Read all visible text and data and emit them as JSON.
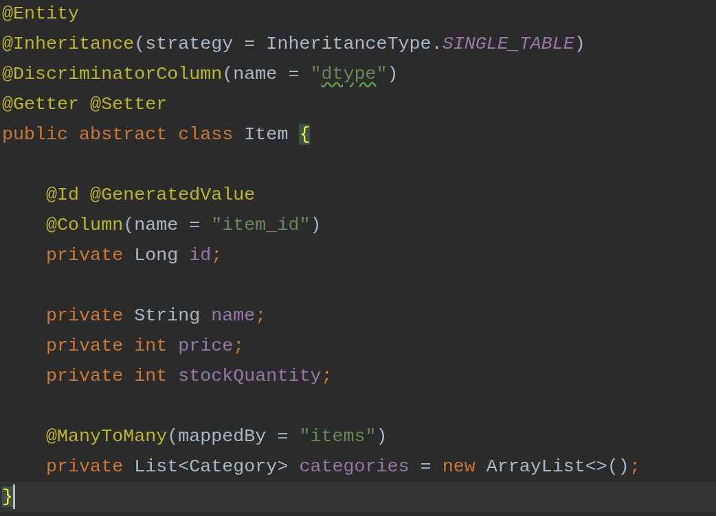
{
  "editor": {
    "lines": [
      {
        "kind": "code",
        "current": false,
        "tokens": [
          {
            "text": "@Entity",
            "kind": "annotation"
          }
        ]
      },
      {
        "kind": "code",
        "current": false,
        "tokens": [
          {
            "text": "@Inheritance",
            "kind": "annotation"
          },
          {
            "text": "(strategy = InheritanceType.",
            "kind": "plain"
          },
          {
            "text": "SINGLE_TABLE",
            "kind": "constant"
          },
          {
            "text": ")",
            "kind": "plain"
          }
        ]
      },
      {
        "kind": "code",
        "current": false,
        "tokens": [
          {
            "text": "@DiscriminatorColumn",
            "kind": "annotation"
          },
          {
            "text": "(name = ",
            "kind": "plain"
          },
          {
            "text": "\"",
            "kind": "string"
          },
          {
            "text": "dtype",
            "kind": "string",
            "squiggle": true
          },
          {
            "text": "\"",
            "kind": "string"
          },
          {
            "text": ")",
            "kind": "plain"
          }
        ]
      },
      {
        "kind": "code",
        "current": false,
        "tokens": [
          {
            "text": "@Getter @Setter",
            "kind": "annotation"
          }
        ]
      },
      {
        "kind": "code",
        "current": false,
        "tokens": [
          {
            "text": "public abstract class ",
            "kind": "keyword"
          },
          {
            "text": "Item ",
            "kind": "plain"
          },
          {
            "text": "{",
            "kind": "brace",
            "matched": true
          }
        ]
      },
      {
        "kind": "blank"
      },
      {
        "kind": "code",
        "current": false,
        "tokens": [
          {
            "text": "    @Id @GeneratedValue",
            "kind": "annotation"
          }
        ]
      },
      {
        "kind": "code",
        "current": false,
        "tokens": [
          {
            "text": "    @Column",
            "kind": "annotation"
          },
          {
            "text": "(name = ",
            "kind": "plain"
          },
          {
            "text": "\"item_id\"",
            "kind": "string"
          },
          {
            "text": ")",
            "kind": "plain"
          }
        ]
      },
      {
        "kind": "code",
        "current": false,
        "tokens": [
          {
            "text": "    private ",
            "kind": "keyword"
          },
          {
            "text": "Long ",
            "kind": "plain"
          },
          {
            "text": "id",
            "kind": "field"
          },
          {
            "text": ";",
            "kind": "keyword"
          }
        ]
      },
      {
        "kind": "blank"
      },
      {
        "kind": "code",
        "current": false,
        "tokens": [
          {
            "text": "    private ",
            "kind": "keyword"
          },
          {
            "text": "String ",
            "kind": "plain"
          },
          {
            "text": "name",
            "kind": "field"
          },
          {
            "text": ";",
            "kind": "keyword"
          }
        ]
      },
      {
        "kind": "code",
        "current": false,
        "tokens": [
          {
            "text": "    private int ",
            "kind": "keyword"
          },
          {
            "text": "price",
            "kind": "field"
          },
          {
            "text": ";",
            "kind": "keyword"
          }
        ]
      },
      {
        "kind": "code",
        "current": false,
        "tokens": [
          {
            "text": "    private int ",
            "kind": "keyword"
          },
          {
            "text": "stockQuantity",
            "kind": "field"
          },
          {
            "text": ";",
            "kind": "keyword"
          }
        ]
      },
      {
        "kind": "blank"
      },
      {
        "kind": "code",
        "current": false,
        "tokens": [
          {
            "text": "    @ManyToMany",
            "kind": "annotation"
          },
          {
            "text": "(mappedBy = ",
            "kind": "plain"
          },
          {
            "text": "\"items\"",
            "kind": "string"
          },
          {
            "text": ")",
            "kind": "plain"
          }
        ]
      },
      {
        "kind": "code",
        "current": false,
        "tokens": [
          {
            "text": "    private ",
            "kind": "keyword"
          },
          {
            "text": "List<Category> ",
            "kind": "plain"
          },
          {
            "text": "categories ",
            "kind": "field"
          },
          {
            "text": "= ",
            "kind": "plain"
          },
          {
            "text": "new ",
            "kind": "keyword"
          },
          {
            "text": "ArrayList<>()",
            "kind": "plain"
          },
          {
            "text": ";",
            "kind": "keyword"
          }
        ]
      },
      {
        "kind": "code",
        "current": true,
        "tokens": [
          {
            "text": "}",
            "kind": "brace",
            "matched": true
          }
        ]
      }
    ]
  }
}
